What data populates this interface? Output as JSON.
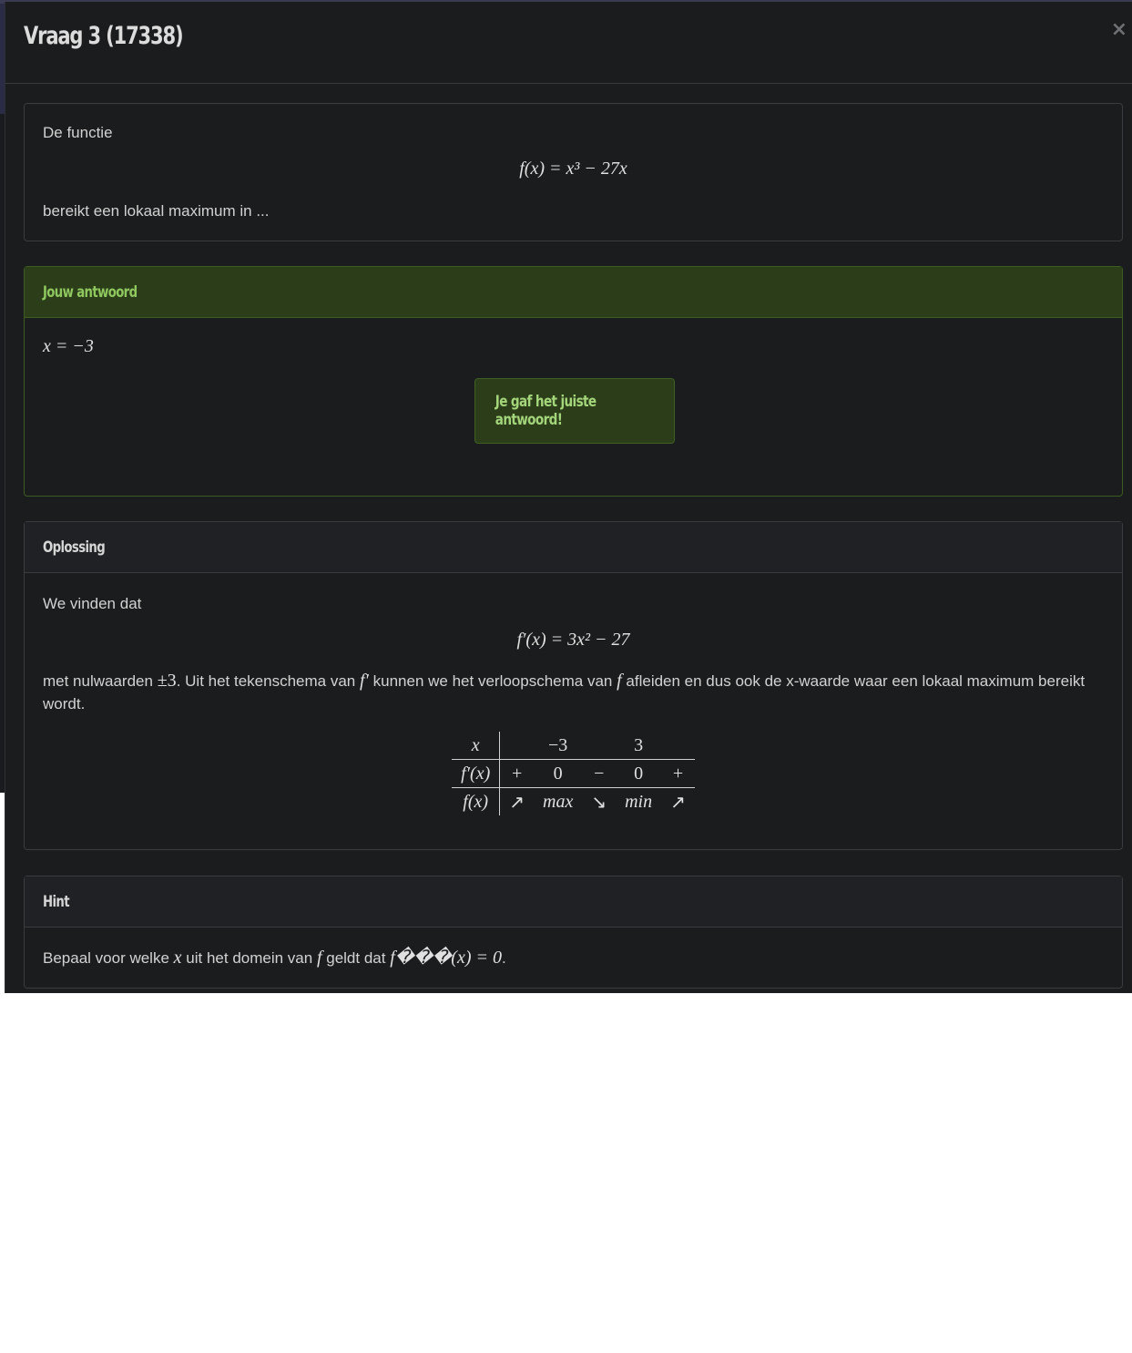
{
  "modal": {
    "title": "Vraag 3 (17338)",
    "close": "×"
  },
  "question": {
    "intro": "De functie",
    "formula": "f(x) = x³ − 27x",
    "outro": "bereikt een lokaal maximum in ..."
  },
  "answer": {
    "header": "Jouw antwoord",
    "value": "x = −3",
    "feedback": "Je gaf het juiste antwoord!"
  },
  "solution": {
    "header": "Oplossing",
    "intro": "We vinden dat",
    "formula": "f′(x) = 3x² − 27",
    "para_1": "met nulwaarden",
    "para_pm3": "±3",
    "para_2": ". Uit het tekenschema van",
    "para_fprime": "f′",
    "para_3": "kunnen we het verloopschema van",
    "para_f": "f",
    "para_4": "afleiden en dus ook de x-waarde waar een lokaal maximum bereikt wordt.",
    "table": {
      "row_x": [
        "x",
        "",
        "−3",
        "",
        "3",
        ""
      ],
      "row_fprime": [
        "f′(x)",
        "+",
        "0",
        "−",
        "0",
        "+"
      ],
      "row_f": [
        "f(x)",
        "↗",
        "max",
        "↘",
        "min",
        "↗"
      ]
    }
  },
  "hint": {
    "header": "Hint",
    "text_1": "Bepaal voor welke",
    "var_x": "x",
    "text_2": "uit het domein van",
    "var_f": "f",
    "text_3": "geldt dat",
    "expr": "f���(x) = 0",
    "text_4": "."
  }
}
